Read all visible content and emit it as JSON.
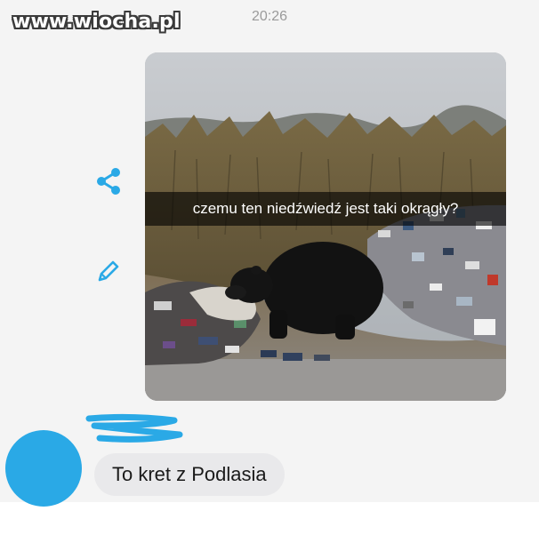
{
  "watermark": "www.wiocha.pl",
  "chat": {
    "timestamp": "20:26",
    "incoming_image": {
      "caption": "czemu ten niedźwiedź jest taki okrągły?"
    },
    "reply": {
      "text": "To kret z Podlasia"
    }
  },
  "icons": {
    "share": "share-icon",
    "edit": "pencil-icon"
  },
  "colors": {
    "accent": "#2aa9e6",
    "bubble_background": "#e9e9eb",
    "caption_overlay": "#000000"
  }
}
